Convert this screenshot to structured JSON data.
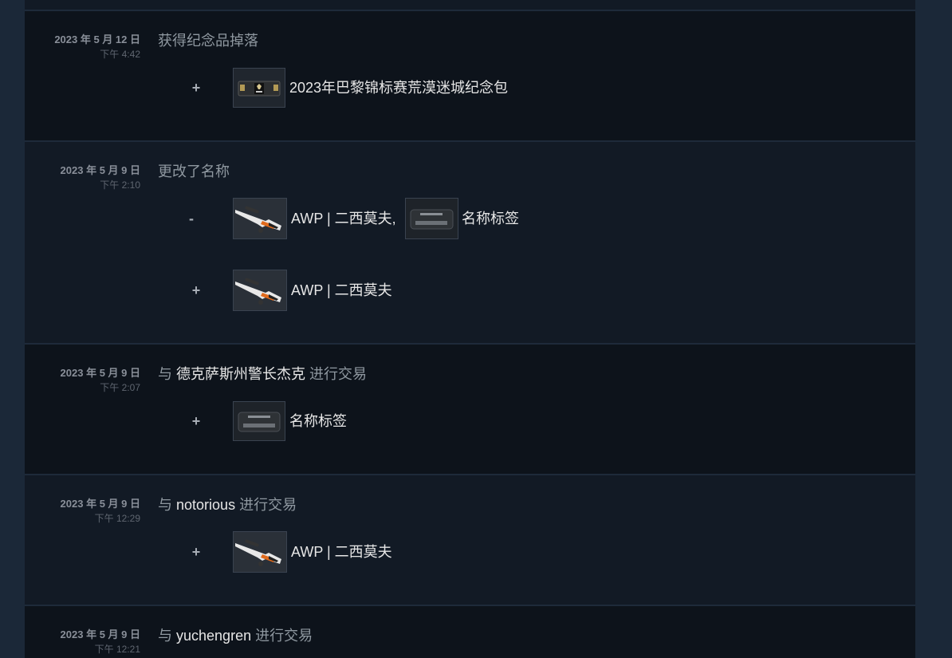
{
  "history": [
    {
      "date": "2023 年 5 月 12 日",
      "time": "下午 4:42",
      "action": "获得纪念品掉落",
      "lines": [
        {
          "sign": "+",
          "items": [
            {
              "name": "2023年巴黎锦标赛荒漠迷城纪念包",
              "icon": "souvenir-package-icon"
            }
          ]
        }
      ]
    },
    {
      "date": "2023 年 5 月 9 日",
      "time": "下午 2:10",
      "action": "更改了名称",
      "lines": [
        {
          "sign": "-",
          "items": [
            {
              "name": "AWP | 二西莫夫,",
              "icon": "awp-rifle-icon"
            },
            {
              "name": "名称标签",
              "icon": "name-tag-icon"
            }
          ]
        },
        {
          "sign": "+",
          "items": [
            {
              "name": "AWP | 二西莫夫",
              "icon": "awp-rifle-icon"
            }
          ]
        }
      ]
    },
    {
      "date": "2023 年 5 月 9 日",
      "time": "下午 2:07",
      "prefix": "与",
      "partner": "德克萨斯州警长杰克",
      "suffix": "进行交易",
      "lines": [
        {
          "sign": "+",
          "items": [
            {
              "name": "名称标签",
              "icon": "name-tag-icon"
            }
          ]
        }
      ]
    },
    {
      "date": "2023 年 5 月 9 日",
      "time": "下午 12:29",
      "prefix": "与",
      "partner": "notorious",
      "suffix": "进行交易",
      "lines": [
        {
          "sign": "+",
          "items": [
            {
              "name": "AWP | 二西莫夫",
              "icon": "awp-rifle-icon"
            }
          ]
        }
      ]
    },
    {
      "date": "2023 年 5 月 9 日",
      "time": "下午 12:21",
      "prefix": "与",
      "partner": "yuchengren",
      "suffix": "进行交易",
      "lines": []
    }
  ],
  "colors": {
    "page_bg": "#1b2838",
    "row_dark": "#0d131b",
    "row_light": "#121a25",
    "item_text": "#e6e6e6",
    "muted_text": "#8f98a0"
  }
}
